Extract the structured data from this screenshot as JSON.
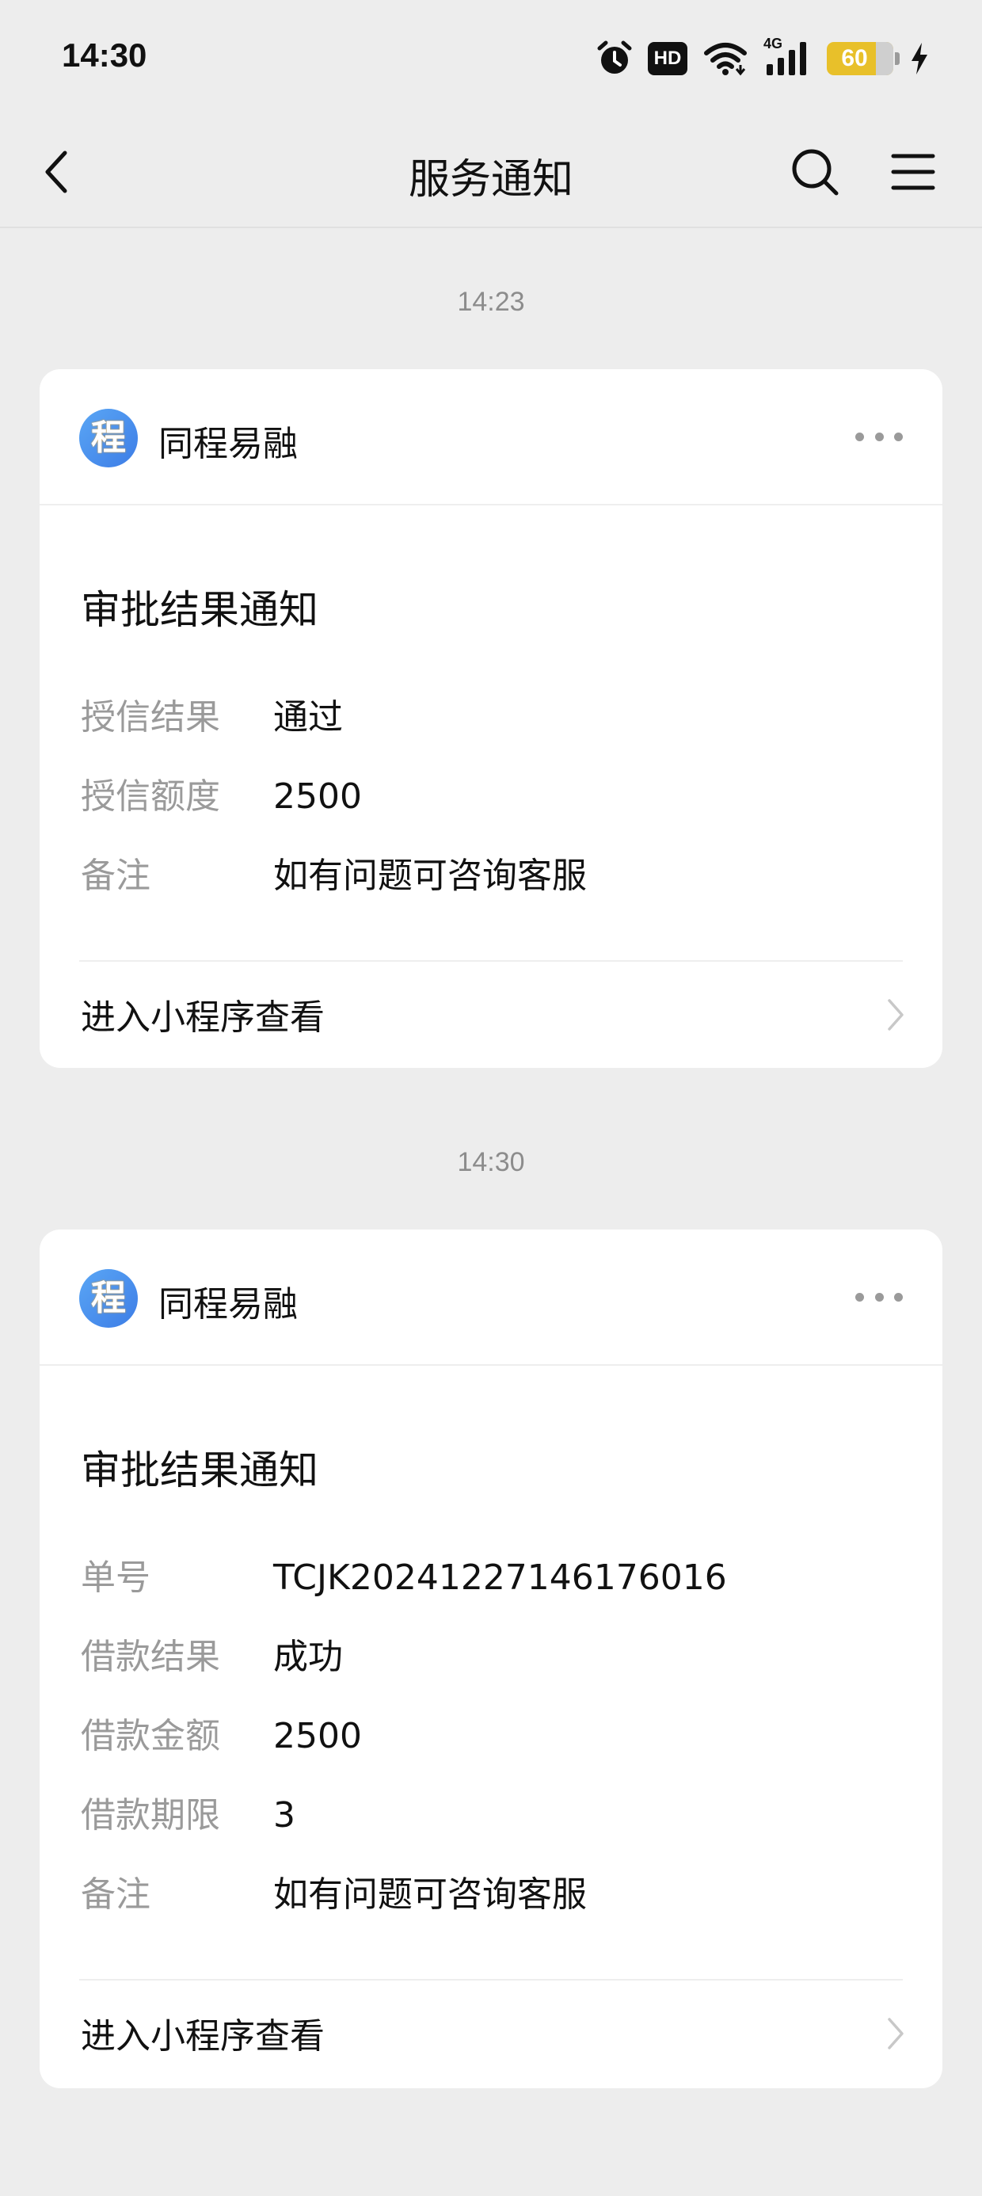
{
  "status_bar": {
    "time": "14:30",
    "hd_label": "HD",
    "network_label": "4G",
    "battery_level": "60",
    "icons": [
      "alarm-icon",
      "hd-icon",
      "wifi-icon",
      "signal-icon",
      "battery-icon",
      "charging-icon"
    ]
  },
  "nav": {
    "title": "服务通知",
    "back_icon": "chevron-left-icon",
    "search_icon": "search-icon",
    "menu_icon": "menu-icon"
  },
  "messages": [
    {
      "timestamp": "14:23",
      "app_name": "同程易融",
      "logo_char": "程",
      "title": "审批结果通知",
      "fields": [
        {
          "label": "授信结果",
          "value": "通过"
        },
        {
          "label": "授信额度",
          "value": "2500"
        },
        {
          "label": "备注",
          "value": "如有问题可咨询客服"
        }
      ],
      "action_label": "进入小程序查看"
    },
    {
      "timestamp": "14:30",
      "app_name": "同程易融",
      "logo_char": "程",
      "title": "审批结果通知",
      "fields": [
        {
          "label": "单号",
          "value": "TCJK20241227146176016"
        },
        {
          "label": "借款结果",
          "value": "成功"
        },
        {
          "label": "借款金额",
          "value": "2500"
        },
        {
          "label": "借款期限",
          "value": "3"
        },
        {
          "label": "备注",
          "value": "如有问题可咨询客服"
        }
      ],
      "action_label": "进入小程序查看"
    }
  ],
  "colors": {
    "background": "#ededed",
    "card": "#ffffff",
    "label_gray": "#9a9a9a",
    "logo_blue": "#4a8ef0",
    "battery_yellow": "#e8c02a"
  }
}
